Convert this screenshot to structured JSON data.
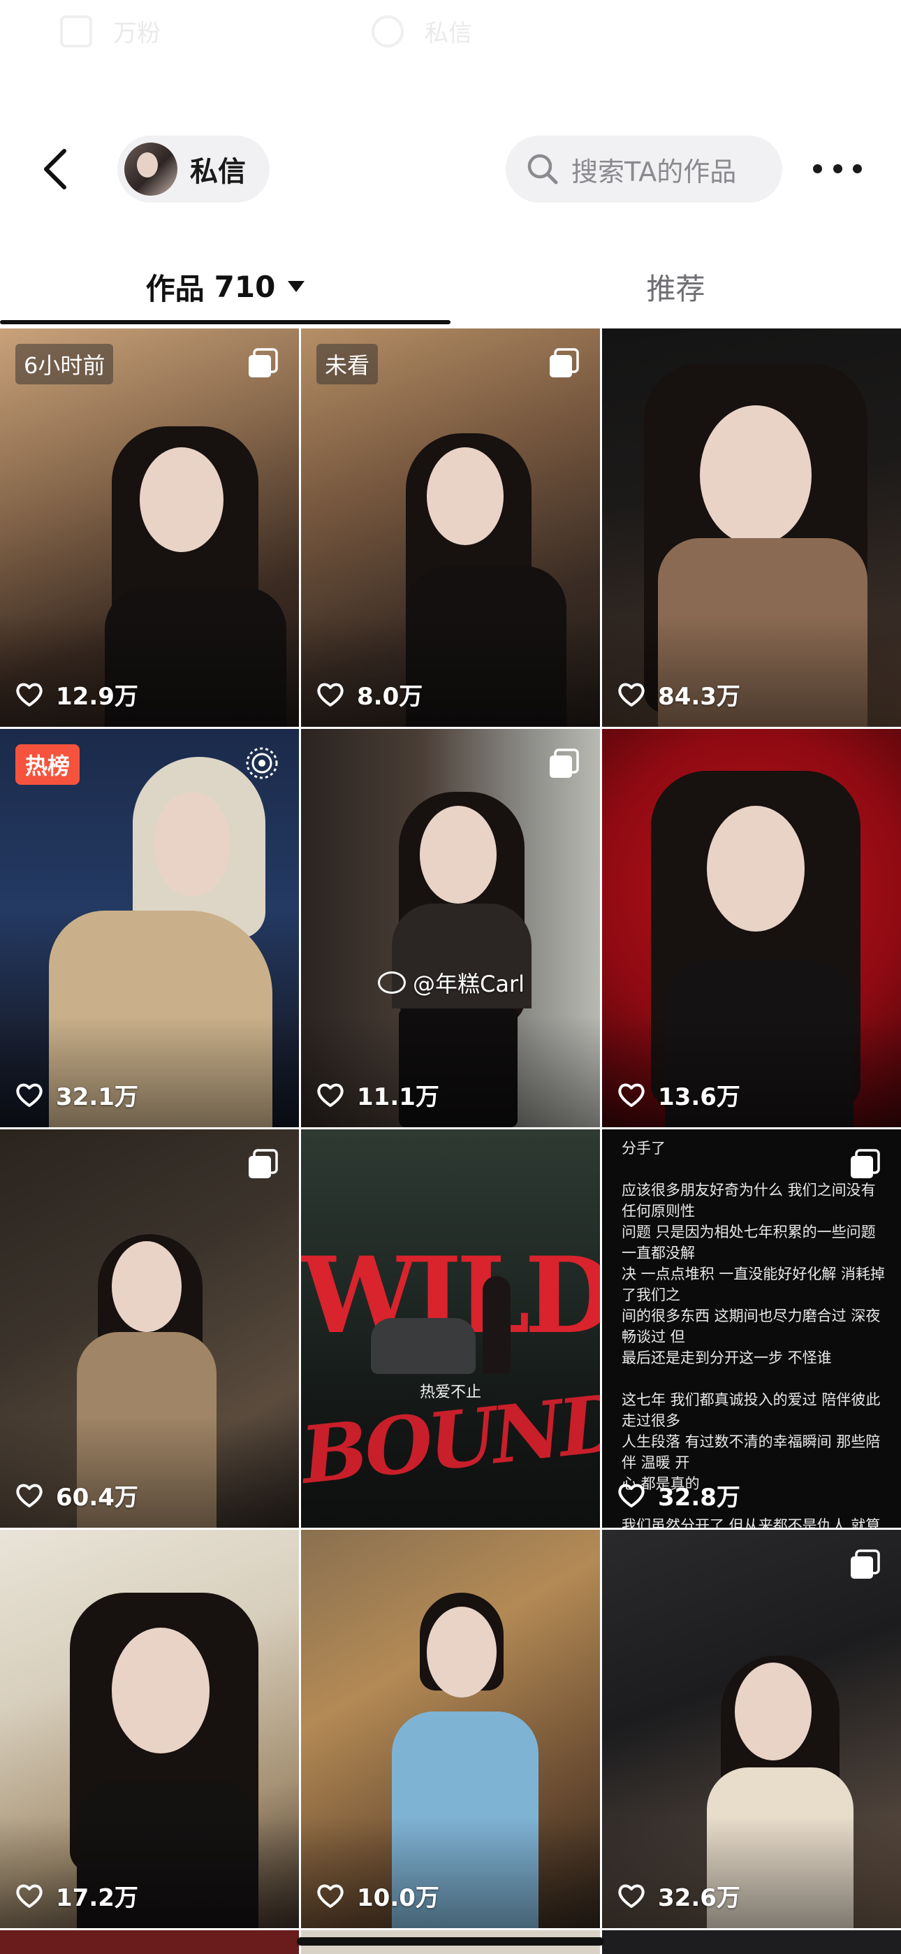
{
  "ghost_top": {
    "left_label": "万粉",
    "right_label": "私信"
  },
  "header": {
    "back_label": "",
    "dm_label": "私信",
    "search_placeholder": "搜索TA的作品"
  },
  "tabs": {
    "works_label": "作品",
    "works_count": "710",
    "recommend_label": "推荐"
  },
  "grid": [
    {
      "likes": "12.9万",
      "badge": "6小时前",
      "badge_type": "time",
      "corner": "multi"
    },
    {
      "likes": "8.0万",
      "badge": "未看",
      "badge_type": "time",
      "corner": "multi"
    },
    {
      "likes": "84.3万",
      "badge": "",
      "badge_type": "",
      "corner": ""
    },
    {
      "likes": "32.1万",
      "badge": "热榜",
      "badge_type": "hot",
      "corner": "live"
    },
    {
      "likes": "11.1万",
      "badge": "",
      "badge_type": "",
      "corner": "multi",
      "watermark": "@年糕Carl"
    },
    {
      "likes": "13.6万",
      "badge": "",
      "badge_type": "",
      "corner": ""
    },
    {
      "likes": "60.4万",
      "badge": "",
      "badge_type": "",
      "corner": "multi"
    },
    {
      "likes": "",
      "badge": "",
      "badge_type": "",
      "corner": "",
      "poster_title": "WILD",
      "poster_sub": "热爱不止",
      "poster_title2": "BOUND"
    },
    {
      "likes": "32.8万",
      "badge": "",
      "badge_type": "",
      "corner": "multi",
      "text_post": "分手了\n\n应该很多朋友好奇为什么 我们之间没有任何原则性\n问题 只是因为相处七年积累的一些问题一直都没解\n决 一点点堆积 一直没能好好化解 消耗掉了我们之\n间的很多东西 这期间也尽力磨合过 深夜畅谈过 但\n最后还是走到分开这一步 不怪谁\n\n这七年 我们都真诚投入的爱过 陪伴彼此走过很多\n人生段落 有过数不清的幸福瞬间 那些陪伴 温暖 开\n心 都是真的\n\n我们虽然分开了 但从来都不是仇人 就算以后不同\n频 也希望对方能好 希望这之后 我们都能带着过往\n的善意 继续好好往前走吧\n\n这段故事就到这里啦 之后就不再多聊这件事了 希望\n大家理解 也麻烦大家多多体谅 不要过度揣测和解读\n\n谢谢大家一直以来对我们的喜欢和支持 不好意思让\n大家失望了 就祝愿大家都能幸福 好好爱\n自己 平安健康 越来越好"
    },
    {
      "likes": "17.2万",
      "badge": "",
      "badge_type": "",
      "corner": ""
    },
    {
      "likes": "10.0万",
      "badge": "",
      "badge_type": "",
      "corner": ""
    },
    {
      "likes": "32.6万",
      "badge": "",
      "badge_type": "",
      "corner": "multi"
    }
  ],
  "colors": {
    "hot_badge": "#f5533d",
    "poster_red": "#d9232d",
    "pill_bg": "#f1f1f3"
  }
}
